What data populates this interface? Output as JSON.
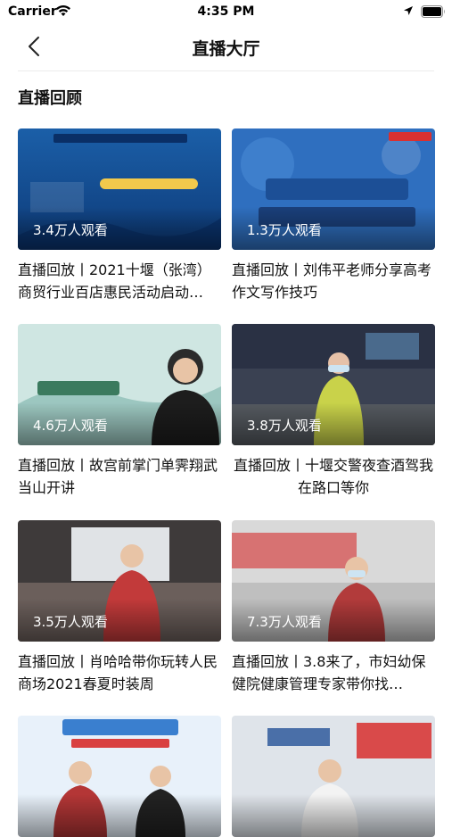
{
  "status_bar": {
    "carrier": "Carrier",
    "time": "4:35 PM"
  },
  "nav": {
    "title": "直播大厅"
  },
  "section": {
    "title": "直播回顾"
  },
  "cards": [
    {
      "views": "3.4万人观看",
      "title": "直播回放丨2021十堰（张湾）商贸行业百店惠民活动启动…"
    },
    {
      "views": "1.3万人观看",
      "title": "直播回放丨刘伟平老师分享高考作文写作技巧"
    },
    {
      "views": "4.6万人观看",
      "title": "直播回放丨故宫前掌门单霁翔武当山开讲"
    },
    {
      "views": "3.8万人观看",
      "title": "直播回放丨十堰交警夜查酒驾我在路口等你"
    },
    {
      "views": "3.5万人观看",
      "title": "直播回放丨肖哈哈带你玩转人民商场2021春夏时装周"
    },
    {
      "views": "7.3万人观看",
      "title": "直播回放丨3.8来了，市妇幼保健院健康管理专家带你找…"
    },
    {
      "views": "",
      "title": ""
    },
    {
      "views": "",
      "title": ""
    }
  ]
}
